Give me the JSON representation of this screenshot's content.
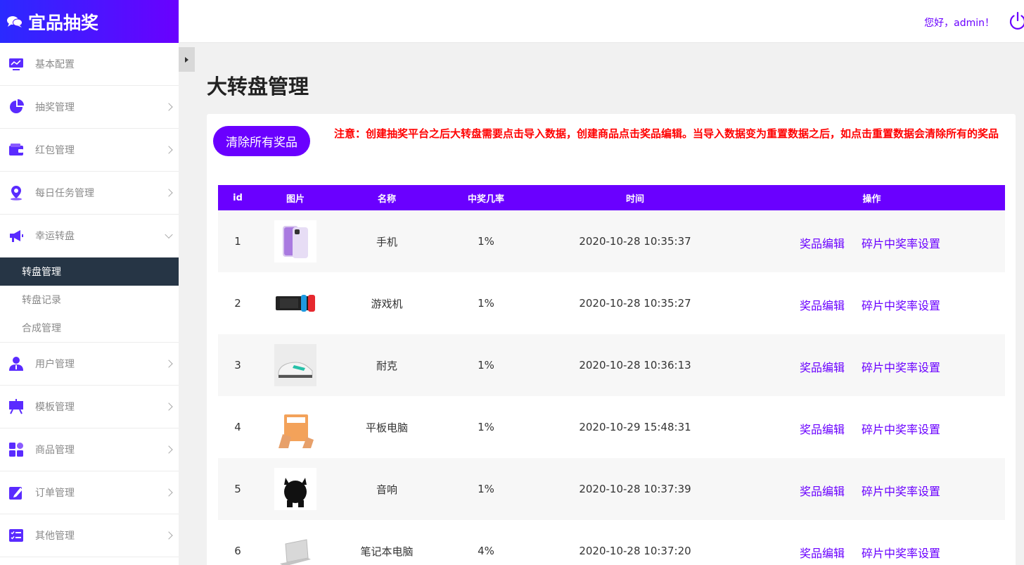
{
  "brand": {
    "title": "宜品抽奖"
  },
  "header": {
    "greeting": "您好，admin！"
  },
  "sidebar": {
    "items": [
      {
        "label": "基本配置",
        "icon": "monitor-chart-icon",
        "has_arrow": false
      },
      {
        "label": "抽奖管理",
        "icon": "pie-chart-icon",
        "has_arrow": true
      },
      {
        "label": "红包管理",
        "icon": "wallet-icon",
        "has_arrow": true
      },
      {
        "label": "每日任务管理",
        "icon": "location-pin-icon",
        "has_arrow": true
      },
      {
        "label": "幸运转盘",
        "icon": "megaphone-icon",
        "has_arrow": true,
        "expanded": true
      },
      {
        "label": "用户管理",
        "icon": "user-icon",
        "has_arrow": true
      },
      {
        "label": "模板管理",
        "icon": "easel-icon",
        "has_arrow": true
      },
      {
        "label": "商品管理",
        "icon": "grid-shapes-icon",
        "has_arrow": true
      },
      {
        "label": "订单管理",
        "icon": "edit-doc-icon",
        "has_arrow": true
      },
      {
        "label": "其他管理",
        "icon": "checklist-icon",
        "has_arrow": true
      }
    ],
    "submenu": [
      {
        "label": "转盘管理",
        "active": true
      },
      {
        "label": "转盘记录",
        "active": false
      },
      {
        "label": "合成管理",
        "active": false
      }
    ]
  },
  "main": {
    "title": "大转盘管理",
    "clear_button": "清除所有奖品",
    "notice": "注意：创建抽奖平台之后大转盘需要点击导入数据，创建商品点击奖品编辑。当导入数据变为重置数据之后，如点击重置数据会清除所有的奖品",
    "table": {
      "headers": [
        "id",
        "图片",
        "名称",
        "中奖几率",
        "时间",
        "操作"
      ],
      "rows": [
        {
          "id": "1",
          "image": "phone-thumbnail",
          "name": "手机",
          "rate": "1%",
          "time": "2020-10-28 10:35:37"
        },
        {
          "id": "2",
          "image": "game-console-thumbnail",
          "name": "游戏机",
          "rate": "1%",
          "time": "2020-10-28 10:35:27"
        },
        {
          "id": "3",
          "image": "sneaker-thumbnail",
          "name": "耐克",
          "rate": "1%",
          "time": "2020-10-28 10:36:13"
        },
        {
          "id": "4",
          "image": "tablet-thumbnail",
          "name": "平板电脑",
          "rate": "1%",
          "time": "2020-10-29 15:48:31"
        },
        {
          "id": "5",
          "image": "speaker-thumbnail",
          "name": "音响",
          "rate": "1%",
          "time": "2020-10-28 10:37:39"
        },
        {
          "id": "6",
          "image": "laptop-thumbnail",
          "name": "笔记本电脑",
          "rate": "4%",
          "time": "2020-10-28 10:37:20"
        }
      ],
      "actions": {
        "edit": "奖品编辑",
        "fragment": "碎片中奖率设置"
      }
    }
  },
  "colors": {
    "accent": "#6a00ff",
    "brand_gradient_start": "#2a2aff",
    "notice": "#ff0000",
    "active_menu": "#263545"
  }
}
